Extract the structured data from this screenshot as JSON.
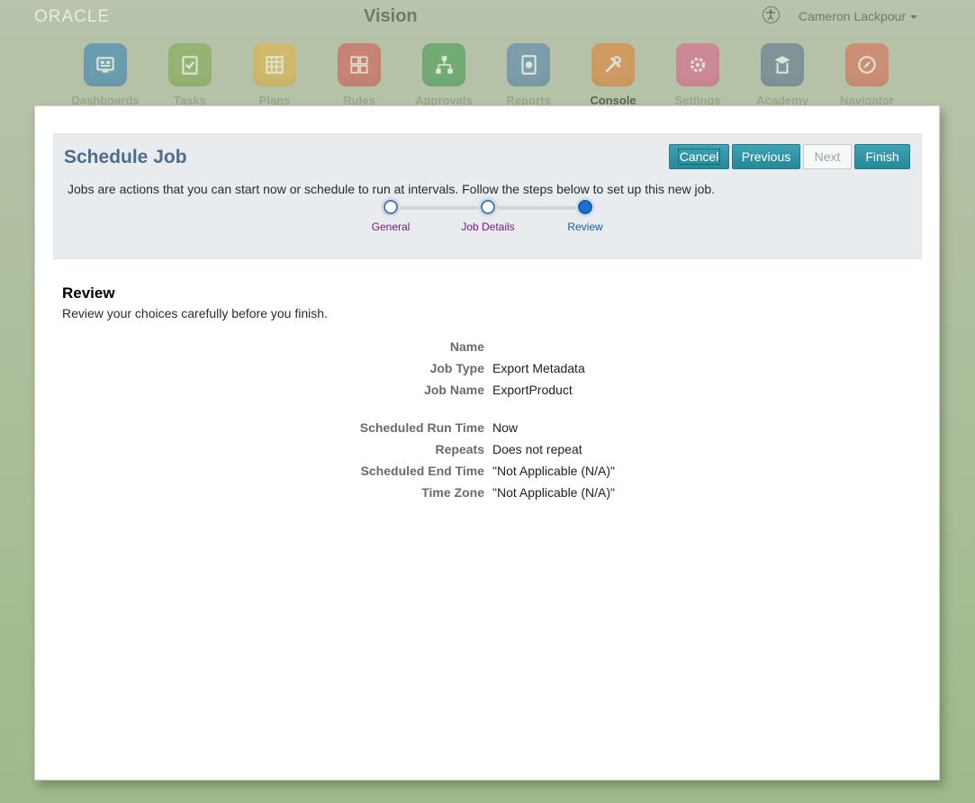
{
  "header": {
    "logo": "ORACLE",
    "app_title": "Vision",
    "user_name": "Cameron Lackpour",
    "nav": [
      {
        "label": "Dashboards",
        "icon": "dashboards-icon",
        "color": "#2f7fb8"
      },
      {
        "label": "Tasks",
        "icon": "tasks-icon",
        "color": "#7fa84a"
      },
      {
        "label": "Plans",
        "icon": "plans-icon",
        "color": "#e6b43a"
      },
      {
        "label": "Rules",
        "icon": "rules-icon",
        "color": "#d9504a"
      },
      {
        "label": "Approvals",
        "icon": "approvals-icon",
        "color": "#3f9a4c"
      },
      {
        "label": "Reports",
        "icon": "reports-icon",
        "color": "#4f7fb0"
      },
      {
        "label": "Console",
        "icon": "console-icon",
        "color": "#e67d2a"
      },
      {
        "label": "Settings",
        "icon": "settings-icon",
        "color": "#e05a86"
      },
      {
        "label": "Academy",
        "icon": "academy-icon",
        "color": "#52708e"
      },
      {
        "label": "Navigator",
        "icon": "navigator-icon",
        "color": "#e0644a"
      }
    ],
    "active_nav": "Console"
  },
  "dialog": {
    "title": "Schedule Job",
    "buttons": {
      "cancel": "Cancel",
      "previous": "Previous",
      "next": "Next",
      "finish": "Finish"
    },
    "description": "Jobs are actions that you can start now or schedule to run at intervals. Follow the steps below to set up this new job.",
    "steps": [
      {
        "label": "General",
        "state": "visited"
      },
      {
        "label": "Job Details",
        "state": "visited"
      },
      {
        "label": "Review",
        "state": "current"
      }
    ],
    "review": {
      "title": "Review",
      "subtitle": "Review your choices carefully before you finish.",
      "rows": [
        {
          "label": "Name",
          "value": ""
        },
        {
          "label": "Job Type",
          "value": "Export Metadata"
        },
        {
          "label": "Job Name",
          "value": "ExportProduct"
        },
        {
          "label": "Scheduled Run Time",
          "value": "Now"
        },
        {
          "label": "Repeats",
          "value": "Does not repeat"
        },
        {
          "label": "Scheduled End Time",
          "value": "\"Not Applicable (N/A)\""
        },
        {
          "label": "Time Zone",
          "value": "\"Not Applicable (N/A)\""
        }
      ]
    }
  }
}
